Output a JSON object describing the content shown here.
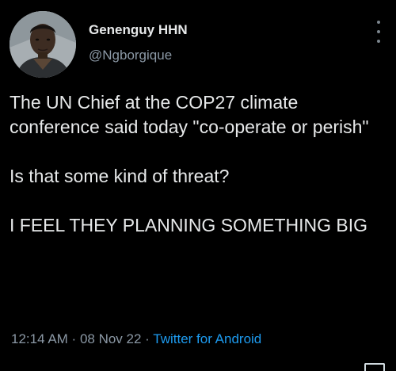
{
  "tweet": {
    "display_name": "Genenguy HHN",
    "username": "@Ngborgique",
    "paragraphs": [
      "The UN Chief at the COP27 climate conference said today \"co-operate or perish\"",
      "Is that some kind of threat?",
      "I FEEL THEY PLANNING SOMETHING BIG"
    ],
    "time": "12:14 AM",
    "separator": " · ",
    "date": "08 Nov 22",
    "source": "Twitter for Android"
  },
  "icons": {
    "more": "more-vertical-icon",
    "corner": "square-icon"
  },
  "colors": {
    "background": "#000000",
    "text": "#e7e9ea",
    "muted": "#8b98a5",
    "link": "#1d9bf0"
  }
}
